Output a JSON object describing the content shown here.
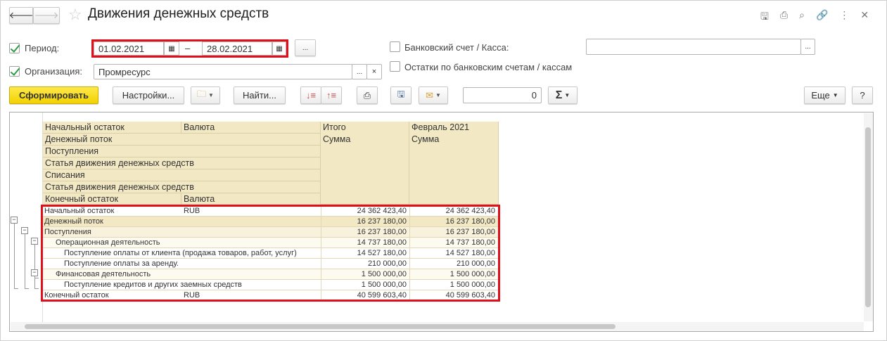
{
  "title": "Движения денежных средств",
  "window_icons": [
    "save-icon",
    "print-icon",
    "preview-icon",
    "link-icon",
    "more-icon",
    "close-icon"
  ],
  "filters": {
    "period_label": "Период:",
    "period_checked": true,
    "date_from": "01.02.2021",
    "date_sep": "–",
    "date_to": "28.02.2021",
    "ellipsis": "...",
    "org_label": "Организация:",
    "org_checked": true,
    "org_value": "Промресурс",
    "clear": "×",
    "bank_label": "Банковский счет / Касса:",
    "bank_value": "",
    "balances_label": "Остатки по банковским счетам / кассам"
  },
  "toolbar": {
    "generate": "Сформировать",
    "settings": "Настройки...",
    "find": "Найти...",
    "counter": "0",
    "sigma": "Σ",
    "more": "Еще",
    "help": "?"
  },
  "report": {
    "header_rows": [
      [
        "Начальный остаток",
        "Валюта"
      ],
      [
        "Денежный поток",
        ""
      ],
      [
        "Поступления",
        ""
      ],
      [
        "Статья движения денежных средств",
        ""
      ],
      [
        "Списания",
        ""
      ],
      [
        "Статья движения денежных средств",
        ""
      ],
      [
        "Конечный остаток",
        "Валюта"
      ]
    ],
    "col_total": "Итого",
    "col_month": "Февраль 2021",
    "sum": "Сумма",
    "rows": [
      {
        "label": "Начальный остаток",
        "currency": "RUB",
        "total": "24 362 423,40",
        "month": "24 362 423,40",
        "level": 0
      },
      {
        "label": "Денежный поток",
        "currency": "",
        "total": "16 237 180,00",
        "month": "16 237 180,00",
        "level": 0
      },
      {
        "label": "Поступления",
        "currency": "",
        "total": "16 237 180,00",
        "month": "16 237 180,00",
        "level": 1
      },
      {
        "label": "Операционная деятельность",
        "currency": "",
        "total": "14 737 180,00",
        "month": "14 737 180,00",
        "level": 2
      },
      {
        "label": "Поступление оплаты от клиента (продажа товаров, работ, услуг)",
        "currency": "",
        "total": "14 527 180,00",
        "month": "14 527 180,00",
        "level": 3
      },
      {
        "label": "Поступление оплаты за аренду.",
        "currency": "",
        "total": "210 000,00",
        "month": "210 000,00",
        "level": 3
      },
      {
        "label": "Финансовая деятельность",
        "currency": "",
        "total": "1 500 000,00",
        "month": "1 500 000,00",
        "level": 2
      },
      {
        "label": "Поступление кредитов и других заемных средств",
        "currency": "",
        "total": "1 500 000,00",
        "month": "1 500 000,00",
        "level": 3
      },
      {
        "label": "Конечный остаток",
        "currency": "RUB",
        "total": "40 599 603,40",
        "month": "40 599 603,40",
        "level": 0
      }
    ]
  }
}
